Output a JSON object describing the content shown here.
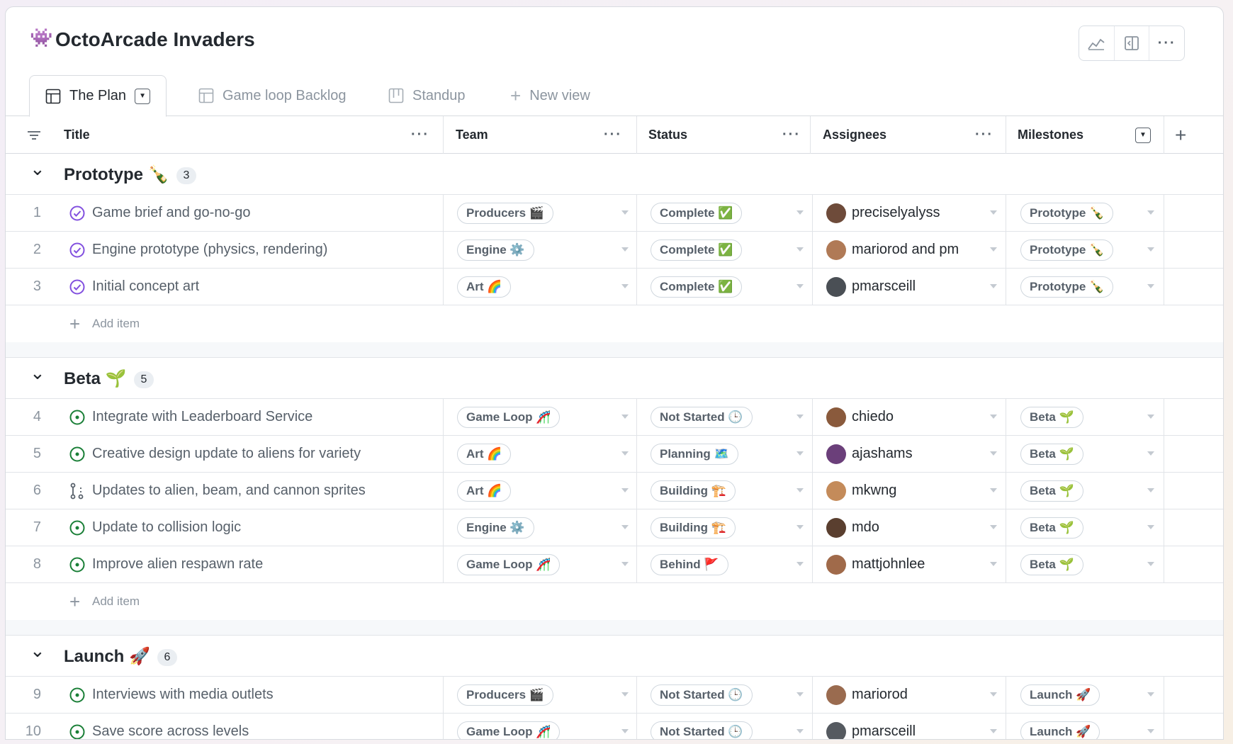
{
  "project": {
    "icon": "👾",
    "title": "OctoArcade Invaders"
  },
  "toolbar": {
    "icons": [
      "graph-icon",
      "sidebar-panel-icon",
      "more-horizontal-icon"
    ],
    "more": "···"
  },
  "tabs": [
    {
      "label": "The Plan",
      "icon": "table-icon",
      "active": true
    },
    {
      "label": "Game loop Backlog",
      "icon": "table-icon"
    },
    {
      "label": "Standup",
      "icon": "board-icon"
    },
    {
      "label": "New view",
      "icon": "plus-icon"
    }
  ],
  "columns": {
    "title": "Title",
    "team": "Team",
    "status": "Status",
    "assignees": "Assignees",
    "milestones": "Milestones",
    "dots": "···",
    "add": "+"
  },
  "add_item": "Add item",
  "groups": [
    {
      "name": "Prototype 🍾",
      "count": "3",
      "rows": [
        {
          "num": "1",
          "state": "done",
          "title": "Game brief and go-no-go",
          "team": "Producers 🎬",
          "status": "Complete ✅",
          "assignee": "preciselyalyss",
          "milestone": "Prototype 🍾"
        },
        {
          "num": "2",
          "state": "done",
          "title": "Engine prototype (physics, rendering)",
          "team": "Engine ⚙️",
          "status": "Complete ✅",
          "assignee": "mariorod and pm",
          "milestone": "Prototype 🍾"
        },
        {
          "num": "3",
          "state": "done",
          "title": "Initial concept art",
          "team": "Art 🌈",
          "status": "Complete ✅",
          "assignee": "pmarsceill",
          "milestone": "Prototype 🍾"
        }
      ]
    },
    {
      "name": "Beta 🌱",
      "count": "5",
      "rows": [
        {
          "num": "4",
          "state": "open",
          "title": "Integrate with Leaderboard Service",
          "team": "Game Loop 🎢",
          "status": "Not Started 🕒",
          "assignee": "chiedo",
          "milestone": "Beta 🌱"
        },
        {
          "num": "5",
          "state": "open",
          "title": "Creative design update to aliens for variety",
          "team": "Art 🌈",
          "status": "Planning 🗺️",
          "assignee": "ajashams",
          "milestone": "Beta 🌱"
        },
        {
          "num": "6",
          "state": "pr",
          "title": "Updates to alien, beam, and cannon sprites",
          "team": "Art 🌈",
          "status": "Building 🏗️",
          "assignee": "mkwng",
          "milestone": "Beta 🌱"
        },
        {
          "num": "7",
          "state": "open",
          "title": "Update to collision logic",
          "team": "Engine ⚙️",
          "status": "Building 🏗️",
          "assignee": "mdo",
          "milestone": "Beta 🌱"
        },
        {
          "num": "8",
          "state": "open",
          "title": "Improve alien respawn rate",
          "team": "Game Loop 🎢",
          "status": "Behind 🚩",
          "assignee": "mattjohnlee",
          "milestone": "Beta 🌱"
        }
      ]
    },
    {
      "name": "Launch 🚀",
      "count": "6",
      "rows": [
        {
          "num": "9",
          "state": "open",
          "title": "Interviews with media outlets",
          "team": "Producers 🎬",
          "status": "Not Started 🕒",
          "assignee": "mariorod",
          "milestone": "Launch 🚀"
        },
        {
          "num": "10",
          "state": "open",
          "title": "Save score across levels",
          "team": "Game Loop 🎢",
          "status": "Not Started 🕒",
          "assignee": "pmarsceill",
          "milestone": "Launch 🚀"
        }
      ]
    }
  ],
  "colors": {
    "done": "#8250df",
    "open": "#1a7f37",
    "pr": "#57606a"
  }
}
